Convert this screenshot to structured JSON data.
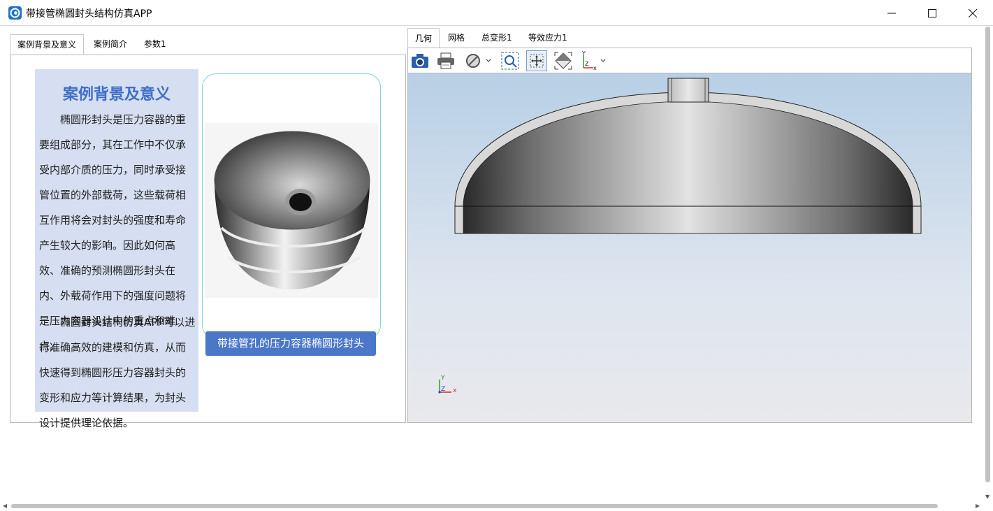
{
  "window": {
    "title": "带接管椭圆封头结构仿真APP"
  },
  "left_tabs": [
    {
      "label": "案例背景及意义",
      "active": true
    },
    {
      "label": "案例简介",
      "active": false
    },
    {
      "label": "参数1",
      "active": false
    }
  ],
  "background_card": {
    "title": "案例背景及意义",
    "paragraph1": "椭圆形封头是压力容器的重要组成部分，其在工作中不仅承受内部介质的压力，同时承受接管位置的外部载荷，这些载荷相互作用将会对封头的强度和寿命产生较大的影响。因此如何高效、准确的预测椭圆形封头在内、外载荷作用下的强度问题将是压力容器设计中的重点和难点。",
    "paragraph2": "椭圆封头结构仿真APP可以进行准确高效的建模和仿真，从而快速得到椭圆形压力容器封头的变形和应力等计算结果，为封头设计提供理论依据。"
  },
  "image_card": {
    "caption": "带接管孔的压力容器椭圆形封头"
  },
  "right_tabs": [
    {
      "label": "几何",
      "active": true
    },
    {
      "label": "网格",
      "active": false
    },
    {
      "label": "总变形1",
      "active": false
    },
    {
      "label": "等效应力1",
      "active": false
    }
  ],
  "toolbar": {
    "icons": [
      "camera-icon",
      "printer-icon",
      "hide-icon",
      "zoom-box-icon",
      "fit-all-icon",
      "view-orient-icon",
      "axis-triad-icon"
    ]
  },
  "viewport": {
    "triad_x": "x",
    "triad_y": "Y",
    "triad_z": "Z"
  }
}
